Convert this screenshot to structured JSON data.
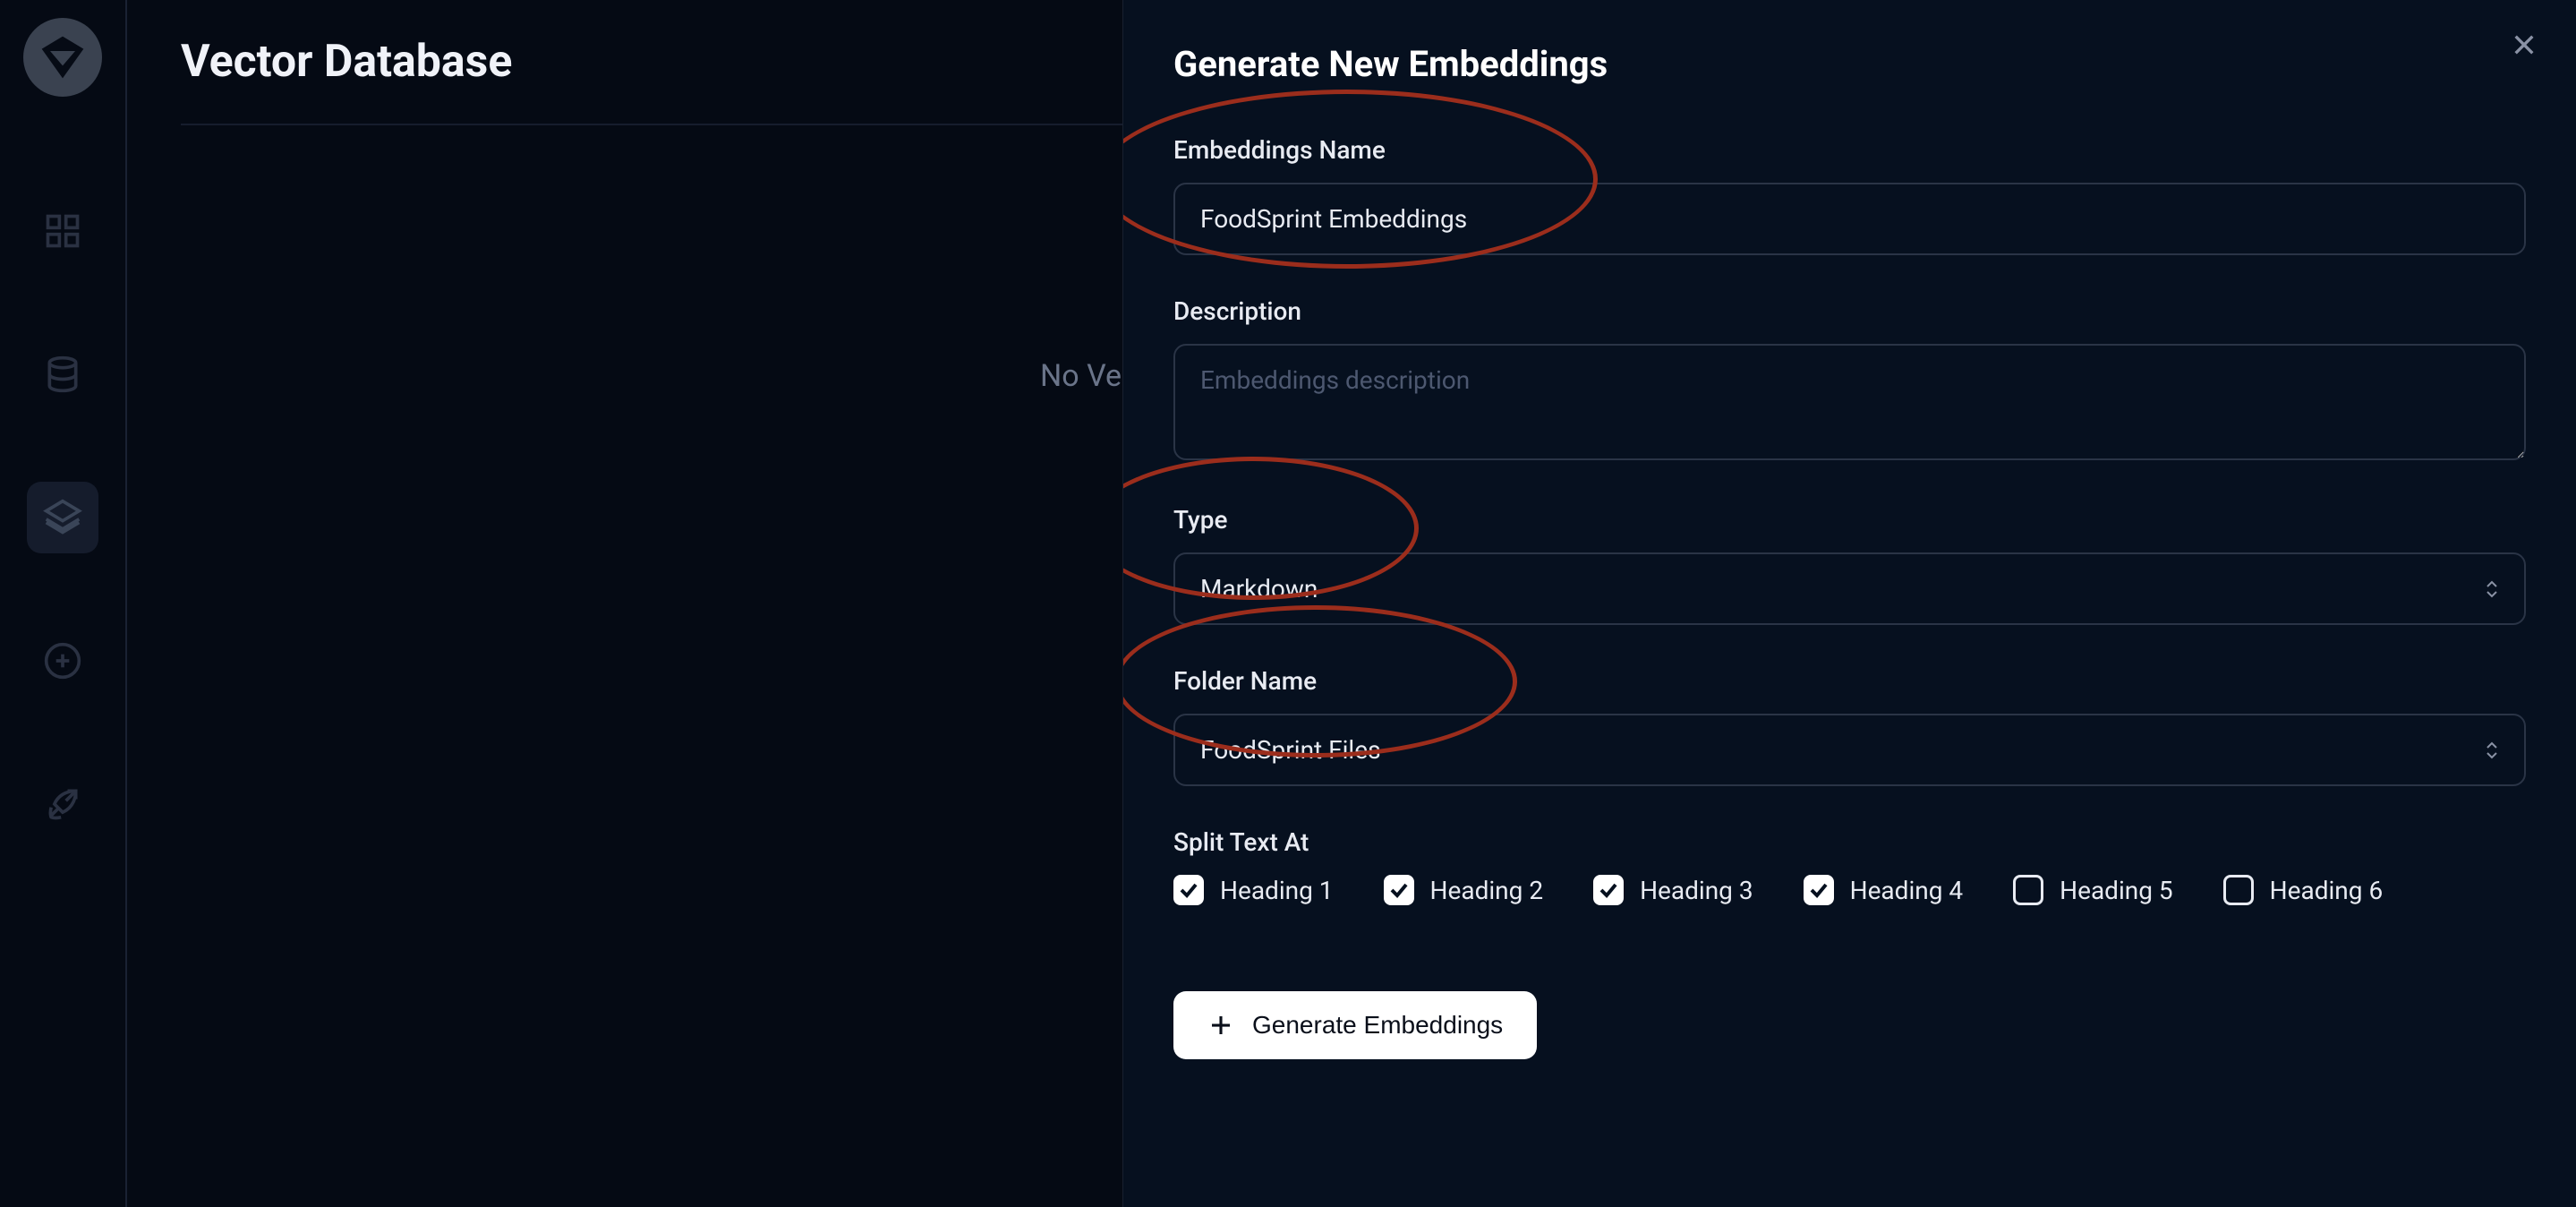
{
  "page": {
    "title": "Vector Database",
    "empty_state_text": "No Vecto"
  },
  "panel": {
    "title": "Generate New Embeddings",
    "fields": {
      "name": {
        "label": "Embeddings Name",
        "value": "FoodSprint Embeddings"
      },
      "description": {
        "label": "Description",
        "placeholder": "Embeddings description",
        "value": ""
      },
      "type": {
        "label": "Type",
        "value": "Markdown"
      },
      "folder": {
        "label": "Folder Name",
        "value": "FoodSprint Files"
      },
      "split": {
        "label": "Split Text At",
        "options": [
          {
            "label": "Heading 1",
            "checked": true
          },
          {
            "label": "Heading 2",
            "checked": true
          },
          {
            "label": "Heading 3",
            "checked": true
          },
          {
            "label": "Heading 4",
            "checked": true
          },
          {
            "label": "Heading 5",
            "checked": false
          },
          {
            "label": "Heading 6",
            "checked": false
          }
        ]
      }
    },
    "action_label": "Generate Embeddings"
  },
  "sidebar": {
    "icons": [
      "dashboard",
      "database",
      "layers",
      "chat-add",
      "launch"
    ]
  }
}
